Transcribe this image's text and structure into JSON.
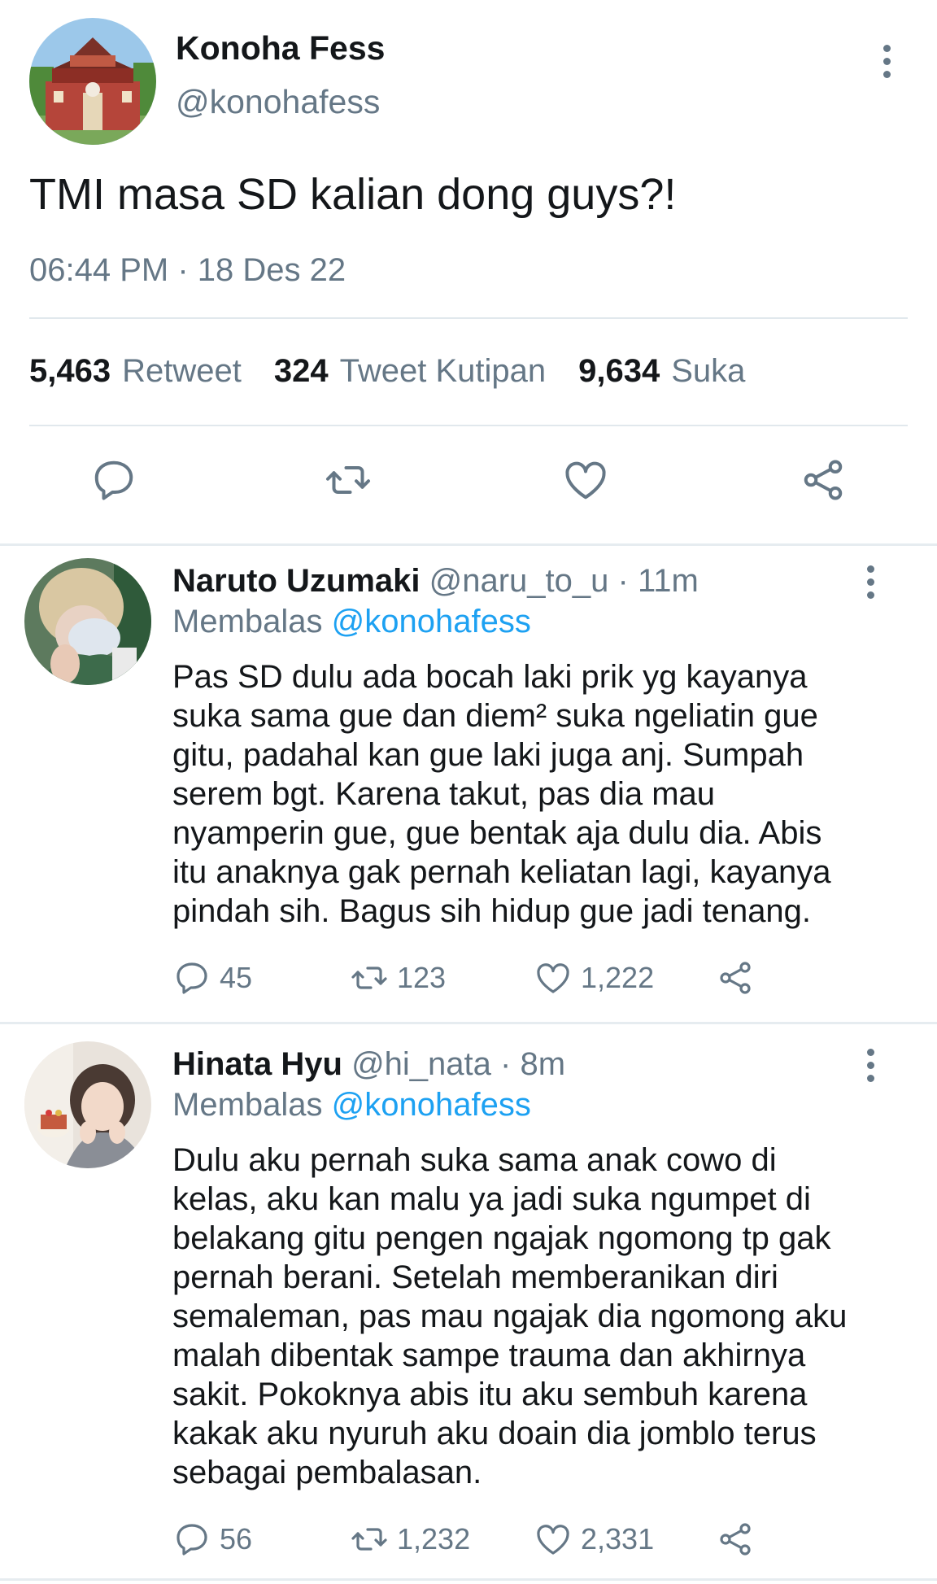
{
  "main_tweet": {
    "name": "Konoha Fess",
    "handle": "@konohafess",
    "text": "TMI masa SD kalian dong guys?!",
    "timestamp": "06:44 PM · 18 Des 22",
    "stats": [
      {
        "count": "5,463",
        "label": "Retweet"
      },
      {
        "count": "324",
        "label": "Tweet Kutipan"
      },
      {
        "count": "9,634",
        "label": "Suka"
      }
    ],
    "actions": [
      "reply-icon",
      "retweet-icon",
      "like-icon",
      "share-icon"
    ]
  },
  "replies": [
    {
      "name": "Naruto Uzumaki",
      "handle": "@naru_to_u",
      "time": "· 11m",
      "replying_label": "Membalas",
      "replying_to": "@konohafess",
      "lines": [
        "Pas SD dulu ada bocah laki prik yg kayanya",
        "suka sama gue dan diem² suka ngeliatin gue",
        "gitu, padahal kan gue laki juga anj. Sumpah",
        "serem bgt. Karena takut, pas dia mau",
        "nyamperin gue, gue bentak aja dulu dia. Abis",
        "itu anaknya gak pernah keliatan lagi, kayanya",
        "pindah sih. Bagus sih hidup gue jadi tenang."
      ],
      "replies_count": "45",
      "retweets": "123",
      "likes": "1,222"
    },
    {
      "name": "Hinata Hyu",
      "handle": "@hi_nata",
      "time": "· 8m",
      "replying_label": "Membalas",
      "replying_to": "@konohafess",
      "lines": [
        "Dulu aku pernah suka sama anak cowo di",
        "kelas, aku kan malu ya jadi suka ngumpet di",
        "belakang gitu pengen ngajak ngomong tp gak",
        "pernah berani. Setelah memberanikan diri",
        "semaleman, pas mau ngajak dia ngomong aku",
        "malah dibentak sampe trauma dan akhirnya",
        "sakit. Pokoknya abis itu aku sembuh karena",
        "kakak aku nyuruh aku doain dia jomblo terus",
        "sebagai pembalasan."
      ],
      "replies_count": "56",
      "retweets": "1,232",
      "likes": "2,331"
    }
  ],
  "colors": {
    "text": "#14171a",
    "muted": "#657786",
    "link": "#1da1f2",
    "divider": "#e1e8ed"
  }
}
